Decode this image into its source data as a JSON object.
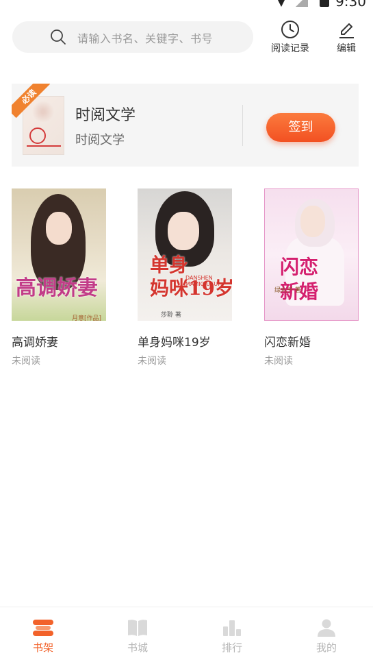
{
  "status_bar": {
    "time": "9:30"
  },
  "header": {
    "search_placeholder": "请输入书名、关键字、书号",
    "history_label": "阅读记录",
    "edit_label": "编辑"
  },
  "featured": {
    "badge": "必读",
    "title": "时阅文学",
    "subtitle": "时阅文学",
    "signin_label": "签到"
  },
  "books": [
    {
      "title": "高调娇妻",
      "status": "未阅读",
      "cover_title": "高调娇妻",
      "cover_sub": "月意[作品]"
    },
    {
      "title": "单身妈咪19岁",
      "status": "未阅读",
      "cover_title_1": "单身",
      "cover_title_2": "妈咪19岁",
      "cover_pinyin": "DANSHEN MAMIQIUSUI",
      "cover_sub": "莎聆 著"
    },
    {
      "title": "闪恋新婚",
      "status": "未阅读",
      "cover_title_1": "闪恋",
      "cover_title_2": "新婚",
      "cover_sub": "绿丸子 著"
    }
  ],
  "nav": [
    {
      "label": "书架",
      "icon": "bookshelf-icon",
      "active": true
    },
    {
      "label": "书城",
      "icon": "book-open-icon",
      "active": false
    },
    {
      "label": "排行",
      "icon": "bar-chart-icon",
      "active": false
    },
    {
      "label": "我的",
      "icon": "user-icon",
      "active": false
    }
  ],
  "colors": {
    "accent": "#f2622a",
    "inactive": "#b5b5b5",
    "card_bg": "#f5f5f5"
  }
}
